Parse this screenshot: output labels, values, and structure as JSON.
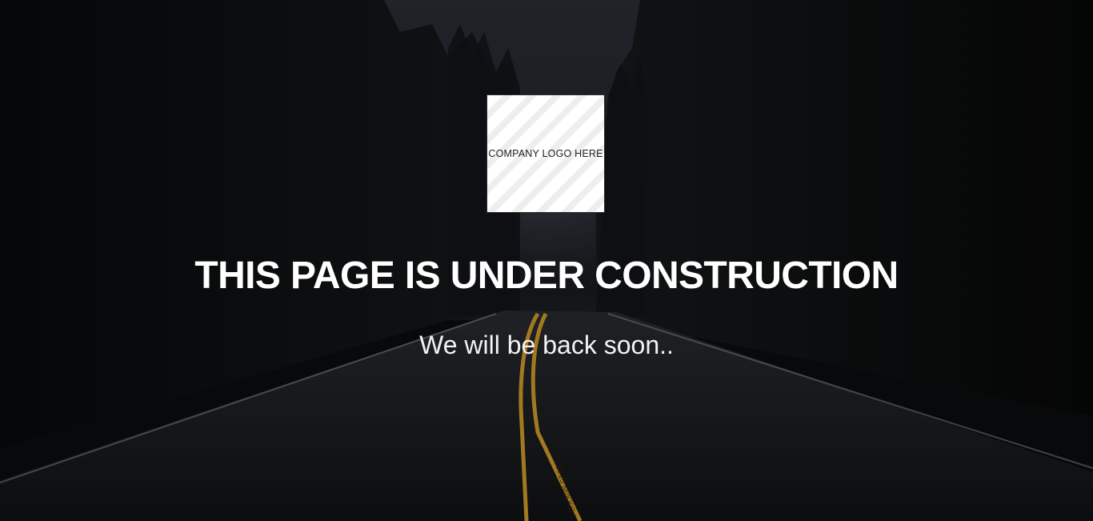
{
  "logo": {
    "text": "COMPANY LOGO HERE"
  },
  "main": {
    "headline": "THIS PAGE IS UNDER CONSTRUCTION",
    "subline": "We will be back soon.."
  },
  "background": {
    "watermark": "© 2013 MIKKO L"
  },
  "colors": {
    "text": "#ffffff",
    "road_line": "#e1a831",
    "background": "#0b0c0e"
  },
  "icons": {
    "logo_placeholder": "striped-placeholder-box"
  }
}
